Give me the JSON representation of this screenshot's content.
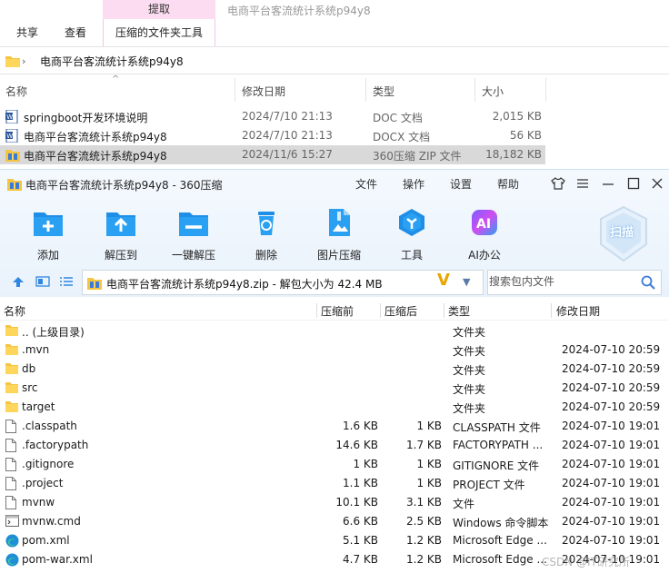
{
  "explorer": {
    "ribbon": {
      "context_label": "提取",
      "window_title": "电商平台客流统计系统p94y8",
      "tabs": [
        "共享",
        "查看",
        "压缩的文件夹工具"
      ]
    },
    "address": "电商平台客流统计系统p94y8",
    "columns": [
      "名称",
      "修改日期",
      "类型",
      "大小"
    ],
    "files": [
      {
        "name": "springboot开发环境说明",
        "date": "2024/7/10 21:13",
        "type": "DOC 文档",
        "size": "2,015 KB",
        "icon": "word-doc-icon"
      },
      {
        "name": "电商平台客流统计系统p94y8",
        "date": "2024/7/10 21:13",
        "type": "DOCX 文档",
        "size": "56 KB",
        "icon": "word-doc-icon"
      },
      {
        "name": "电商平台客流统计系统p94y8",
        "date": "2024/11/6 15:27",
        "type": "360压缩 ZIP 文件",
        "size": "18,182 KB",
        "icon": "zip-archive-icon"
      }
    ]
  },
  "zip360": {
    "title": "电商平台客流统计系统p94y8 - 360压缩",
    "menus": [
      "文件",
      "操作",
      "设置",
      "帮助"
    ],
    "toolbar": [
      {
        "label": "添加",
        "icon": "add-icon"
      },
      {
        "label": "解压到",
        "icon": "extract-to-icon"
      },
      {
        "label": "一键解压",
        "icon": "one-click-extract-icon"
      },
      {
        "label": "删除",
        "icon": "delete-icon"
      },
      {
        "label": "图片压缩",
        "icon": "image-compress-icon"
      },
      {
        "label": "工具",
        "icon": "tools-icon"
      },
      {
        "label": "AI办公",
        "icon": "ai-office-icon"
      }
    ],
    "scan_label": "扫描",
    "path_text": "电商平台客流统计系统p94y8.zip - 解包大小为 42.4 MB",
    "search_placeholder": "搜索包内文件",
    "columns": [
      "名称",
      "压缩前",
      "压缩后",
      "类型",
      "修改日期"
    ],
    "files": [
      {
        "name": ".. (上级目录)",
        "before": "",
        "after": "",
        "type": "文件夹",
        "modified": "",
        "icon": "folder-icon"
      },
      {
        "name": ".mvn",
        "before": "",
        "after": "",
        "type": "文件夹",
        "modified": "2024-07-10 20:59",
        "icon": "folder-icon"
      },
      {
        "name": "db",
        "before": "",
        "after": "",
        "type": "文件夹",
        "modified": "2024-07-10 20:59",
        "icon": "folder-icon"
      },
      {
        "name": "src",
        "before": "",
        "after": "",
        "type": "文件夹",
        "modified": "2024-07-10 20:59",
        "icon": "folder-icon"
      },
      {
        "name": "target",
        "before": "",
        "after": "",
        "type": "文件夹",
        "modified": "2024-07-10 20:59",
        "icon": "folder-icon"
      },
      {
        "name": ".classpath",
        "before": "1.6 KB",
        "after": "1 KB",
        "type": "CLASSPATH 文件",
        "modified": "2024-07-10 19:01",
        "icon": "file-icon"
      },
      {
        "name": ".factorypath",
        "before": "14.6 KB",
        "after": "1.7 KB",
        "type": "FACTORYPATH ...",
        "modified": "2024-07-10 19:01",
        "icon": "file-icon"
      },
      {
        "name": ".gitignore",
        "before": "1 KB",
        "after": "1 KB",
        "type": "GITIGNORE 文件",
        "modified": "2024-07-10 19:01",
        "icon": "file-icon"
      },
      {
        "name": ".project",
        "before": "1.1 KB",
        "after": "1 KB",
        "type": "PROJECT 文件",
        "modified": "2024-07-10 19:01",
        "icon": "file-icon"
      },
      {
        "name": "mvnw",
        "before": "10.1 KB",
        "after": "3.1 KB",
        "type": "文件",
        "modified": "2024-07-10 19:01",
        "icon": "file-icon"
      },
      {
        "name": "mvnw.cmd",
        "before": "6.6 KB",
        "after": "2.5 KB",
        "type": "Windows 命令脚本",
        "modified": "2024-07-10 19:01",
        "icon": "cmd-script-icon"
      },
      {
        "name": "pom.xml",
        "before": "5.1 KB",
        "after": "1.2 KB",
        "type": "Microsoft Edge ...",
        "modified": "2024-07-10 19:01",
        "icon": "edge-icon"
      },
      {
        "name": "pom-war.xml",
        "before": "4.7 KB",
        "after": "1.2 KB",
        "type": "Microsoft Edge ...",
        "modified": "2024-07-10 19:01",
        "icon": "edge-icon"
      }
    ]
  },
  "watermark": "CSDN @IT研究所"
}
